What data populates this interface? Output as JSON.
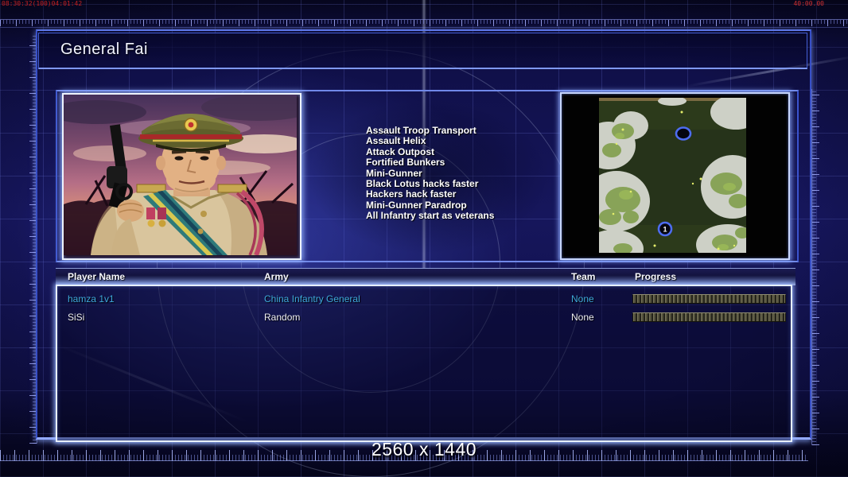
{
  "debug_overlay": {
    "top_left": "08:30:32(100)04:01:42",
    "top_right": "40:00.00"
  },
  "header": {
    "title": "General Fai"
  },
  "abilities": [
    "Assault Troop Transport",
    "Assault Helix",
    "Attack Outpost",
    "Fortified Bunkers",
    "Mini-Gunner",
    "Black Lotus hacks faster",
    "Hackers hack faster",
    "Mini-Gunner Paradrop",
    "All Infantry start as veterans"
  ],
  "players": {
    "headers": {
      "name": "Player Name",
      "army": "Army",
      "team": "Team",
      "progress": "Progress"
    },
    "rows": [
      {
        "name": "hamza 1v1",
        "army": "China Infantry General",
        "team": "None",
        "progress_percent": 100,
        "accent": true
      },
      {
        "name": "SiSi",
        "army": "Random",
        "team": "None",
        "progress_percent": 100,
        "accent": false
      }
    ]
  },
  "map_preview": {
    "markers": [
      {
        "label": ""
      },
      {
        "label": "1"
      }
    ]
  },
  "footer": {
    "resolution_label": "2560 x 1440"
  },
  "colors": {
    "accent_text": "#3fa9dc",
    "normal_text": "#eeeef5",
    "panel_glow": "#e8f0ff",
    "progress_fill": "#54523d"
  }
}
